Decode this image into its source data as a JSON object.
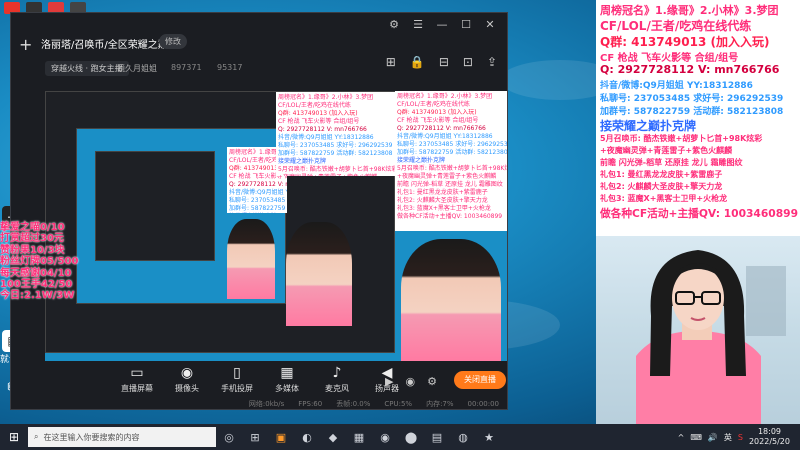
{
  "app": {
    "title_bar_buttons": [
      "⚙",
      "☰",
      "—",
      "☐",
      "✕"
    ],
    "room": {
      "title": "洛丽塔/召唤币/全区荣耀之巅",
      "tag": "修改",
      "category": "穿越火线 · 跑女主播",
      "owner": "镜久月姐姐",
      "room_id": "897371",
      "heat": "95317"
    },
    "header_tools": [
      "⊞",
      "🔒",
      "⊟",
      "⊡",
      "⇪"
    ],
    "toolbar": [
      {
        "icon": "▭",
        "label": "直播屏幕"
      },
      {
        "icon": "◉",
        "label": "摄像头"
      },
      {
        "icon": "▯",
        "label": "手机投屏"
      },
      {
        "icon": "▦",
        "label": "多媒体"
      },
      {
        "icon": "♪",
        "label": "麦克风"
      },
      {
        "icon": "◀",
        "label": "扬声器"
      }
    ],
    "side_tools": [
      "▶",
      "◉",
      "⚙"
    ],
    "go_live_label": "关闭直播",
    "status": [
      "网络:0kb/s",
      "FPS:60",
      "丢帧:0.0%",
      "CPU:5%",
      "内存:7%",
      "00:00:00"
    ]
  },
  "overlay_stats": [
    "挚爱之喵0/10",
    "打赏超过30元",
    "赞粉果10/3块",
    "粉丝灯牌05/500",
    "每天感谢04/10",
    "100王手42/50",
    "今日:2.1W/3W"
  ],
  "right_panel": {
    "lines": [
      {
        "text": "周榜冠名》1.缘哥》2.小林》3.梦团",
        "color": "#ff2d7a",
        "size": 11
      },
      {
        "text": "CF/LOL/王者/吃鸡在线代练",
        "color": "#ff2d7a",
        "size": 12
      },
      {
        "text": "Q群: 413749013 (加入入玩)",
        "color": "#ff1f4f",
        "size": 12
      },
      {
        "text": "CF 枪战 飞车火影等 合组/组号",
        "color": "#ff2d7a",
        "size": 10
      },
      {
        "text": "Q: 2927728112 V: mn766766",
        "color": "#d4003f",
        "size": 11
      },
      {
        "text": "抖音/微博:Q9月姐姐 YY:18312886",
        "color": "#2f9bff",
        "size": 9
      },
      {
        "text": "私聊号: 237053485 求好号: 296292539",
        "color": "#2f9bff",
        "size": 9
      },
      {
        "text": "加群号: 587822759 活动群: 582123808",
        "color": "#2f9bff",
        "size": 9
      },
      {
        "text": "接荣耀之巅扑克牌",
        "color": "#2f6bff",
        "size": 12
      },
      {
        "text": "5月召唤币: 酷杰铁嫩+胡萝卜匕首+98K炫彩",
        "color": "#ff2d7a",
        "size": 8
      },
      {
        "text": "+夜魔幽灵弹+青莲雷子+紫色火麒麟",
        "color": "#ff2d7a",
        "size": 8
      },
      {
        "text": "前瞻 闪光弹-稻草 还原挂 龙儿 霜雕图纹",
        "color": "#ff2d7a",
        "size": 8
      },
      {
        "text": "礼包1: 曼红黑龙龙皮肤+紫雷鹿子",
        "color": "#ff2d7a",
        "size": 8
      },
      {
        "text": "礼包2: 火麒麟大圣皮肤+擎天力龙",
        "color": "#ff2d7a",
        "size": 8
      },
      {
        "text": "礼包3: 蓝魔X+黑客士卫甲+火枪龙",
        "color": "#ff2d7a",
        "size": 8
      },
      {
        "text": "做各种CF活动+主播QV: 1003460899",
        "color": "#ff2d7a",
        "size": 11
      }
    ]
  },
  "taskbar": {
    "search_placeholder": "在这里输入你要搜索的内容",
    "apps": [
      "◎",
      "⊞",
      "▣",
      "◐",
      "◆",
      "▦",
      "◉",
      "⬤",
      "▤",
      "◍",
      "★"
    ],
    "tray": [
      "^",
      "⌨",
      "🔊",
      "英",
      "S"
    ],
    "time": "18:09",
    "date": "2022/5/20"
  },
  "desktop": {
    "label_1": "就说助手"
  }
}
